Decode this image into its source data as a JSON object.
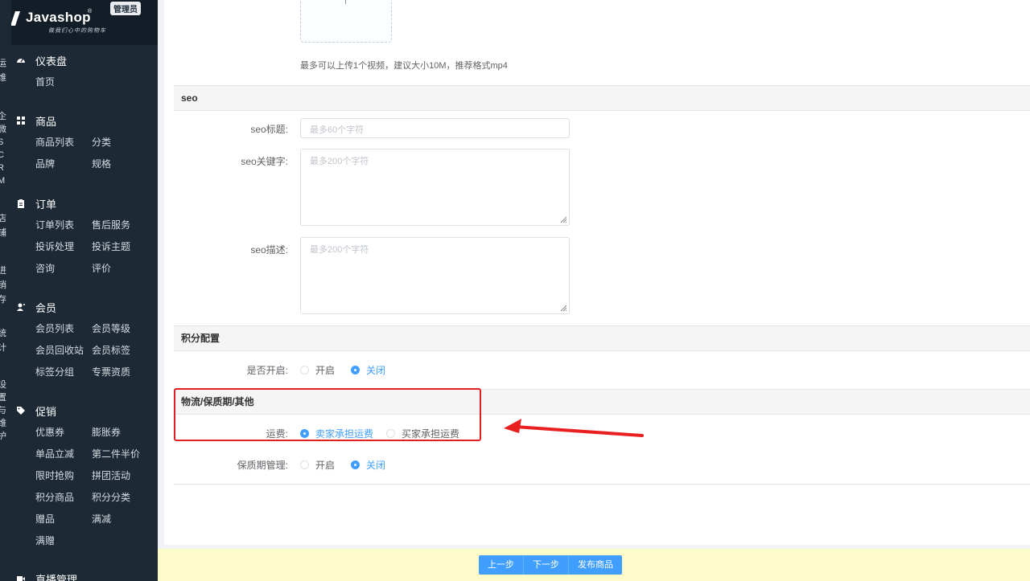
{
  "brand": {
    "name": "Javashop",
    "slogan": "做我们心中的购物车",
    "badge": "管理员"
  },
  "rail": {
    "groups": [
      {
        "chars": [
          "运",
          "维"
        ]
      },
      {
        "chars": [
          "企",
          "微",
          "S",
          "C",
          "R",
          "M"
        ]
      },
      {
        "chars": [
          "店",
          "铺"
        ]
      },
      {
        "chars": [
          "进",
          "销",
          "存"
        ]
      },
      {
        "chars": [
          "统",
          "计"
        ]
      },
      {
        "chars": [
          "设",
          "置",
          "与",
          "维",
          "护"
        ]
      }
    ]
  },
  "sidebar": {
    "sections": [
      {
        "title": "仪表盘",
        "icon": "dashboard-icon",
        "items": [
          "首页"
        ]
      },
      {
        "title": "商品",
        "icon": "grid-icon",
        "items": [
          "商品列表",
          "分类",
          "品牌",
          "规格"
        ]
      },
      {
        "title": "订单",
        "icon": "clipboard-icon",
        "items": [
          "订单列表",
          "售后服务",
          "投诉处理",
          "投诉主题",
          "咨询",
          "评价"
        ]
      },
      {
        "title": "会员",
        "icon": "user-icon",
        "items": [
          "会员列表",
          "会员等级",
          "会员回收站",
          "会员标签",
          "标签分组",
          "专票资质"
        ]
      },
      {
        "title": "促销",
        "icon": "tag-icon",
        "items": [
          "优惠券",
          "膨胀券",
          "单品立减",
          "第二件半价",
          "限时抢购",
          "拼团活动",
          "积分商品",
          "积分分类",
          "赠品",
          "满减",
          "满赠"
        ]
      },
      {
        "title": "直播管理",
        "icon": "live-icon",
        "items": []
      }
    ]
  },
  "upload": {
    "tip": "最多可以上传1个视频，建议大小10M，推荐格式mp4"
  },
  "seo": {
    "section_title": "seo",
    "title_label": "seo标题:",
    "title_placeholder": "最多60个字符",
    "keywords_label": "seo关键字:",
    "keywords_placeholder": "最多200个字符",
    "desc_label": "seo描述:",
    "desc_placeholder": "最多200个字符"
  },
  "points": {
    "section_title": "积分配置",
    "enable_label": "是否开启:",
    "options": [
      "开启",
      "关闭"
    ],
    "selected": "关闭"
  },
  "logistics": {
    "section_title": "物流/保质期/其他",
    "freight_label": "运费:",
    "freight_options": [
      "卖家承担运费",
      "买家承担运费"
    ],
    "freight_selected": "卖家承担运费",
    "shelf_label": "保质期管理:",
    "shelf_options": [
      "开启",
      "关闭"
    ],
    "shelf_selected": "关闭"
  },
  "footer": {
    "prev": "上一步",
    "next": "下一步",
    "publish": "发布商品"
  },
  "colors": {
    "sidebar": "#1d2a36",
    "accent": "#409eff",
    "highlight": "#e02020",
    "footer": "#fdfbc9"
  }
}
